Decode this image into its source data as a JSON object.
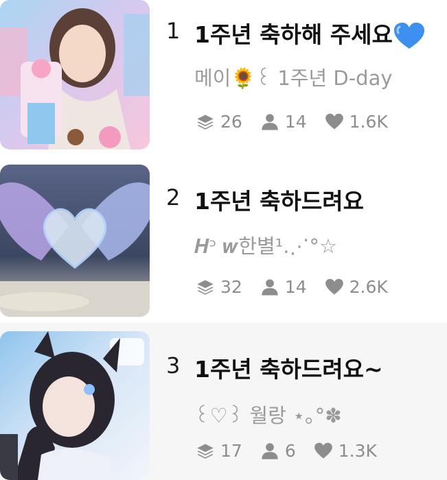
{
  "items": [
    {
      "rank": "1",
      "title": "1주년 축하해 주세요",
      "title_emoji": "blue-heart",
      "author": "메이🌻꒰ 1주년 D-day",
      "stats": {
        "parts": "26",
        "readers": "14",
        "likes": "1.6K"
      }
    },
    {
      "rank": "2",
      "title": "1주년 축하드려요",
      "author": "𝑯ᵓ 𝒘한별¹.⋰°☆",
      "stats": {
        "parts": "32",
        "readers": "14",
        "likes": "2.6K"
      }
    },
    {
      "rank": "3",
      "title": "1주년 축하드려요~",
      "author": "꒰♡꒱ 월랑 ⋆｡°✽",
      "stats": {
        "parts": "17",
        "readers": "6",
        "likes": "1.3K"
      }
    }
  ],
  "colors": {
    "title": "#111111",
    "meta": "#9a9a9a",
    "highlight_row_bg": "#f6f6f6",
    "heart_emoji": "#3d8ff0"
  }
}
